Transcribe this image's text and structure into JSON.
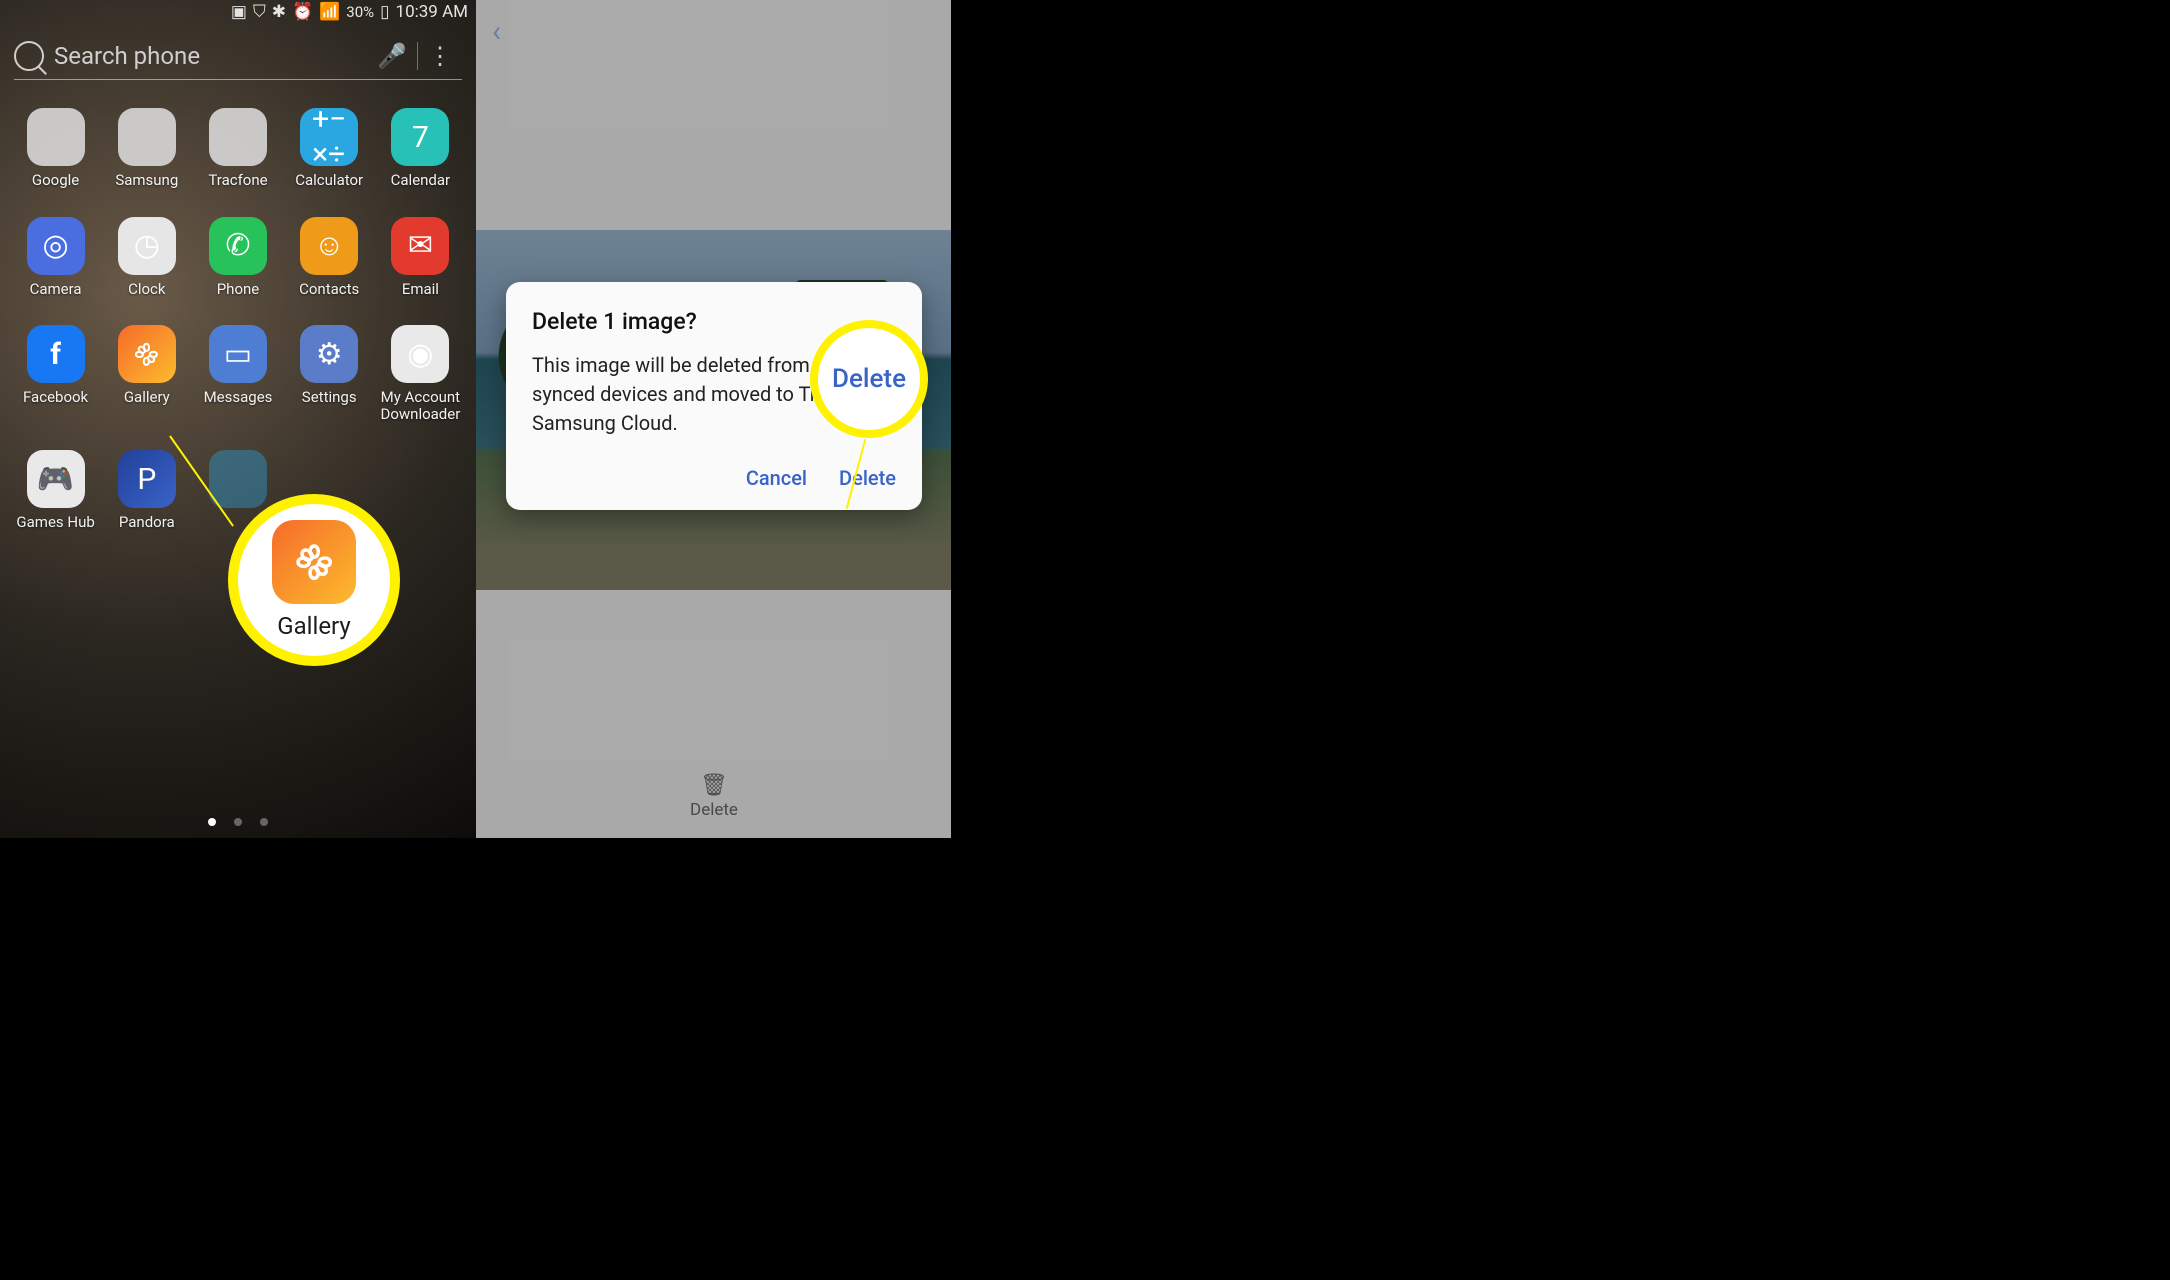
{
  "status": {
    "battery": "30%",
    "time": "10:39 AM"
  },
  "search": {
    "placeholder": "Search phone"
  },
  "apps_row1": [
    "Google",
    "Samsung",
    "Tracfone",
    "Calculator",
    "Calendar"
  ],
  "apps_row2": [
    "Camera",
    "Clock",
    "Phone",
    "Contacts",
    "Email"
  ],
  "apps_row3": [
    "Facebook",
    "Gallery",
    "Messages",
    "Settings",
    "My Account Downloader"
  ],
  "apps_row4": [
    "Games Hub",
    "Pandora"
  ],
  "callout1_label": "Gallery",
  "delete_label": "Delete",
  "dialog": {
    "title": "Delete 1 image?",
    "body": "This image will be deleted from your synced devices and moved to Trash in Samsung Cloud.",
    "cancel": "Cancel",
    "confirm": "Delete"
  },
  "callout3_label": "Delete"
}
